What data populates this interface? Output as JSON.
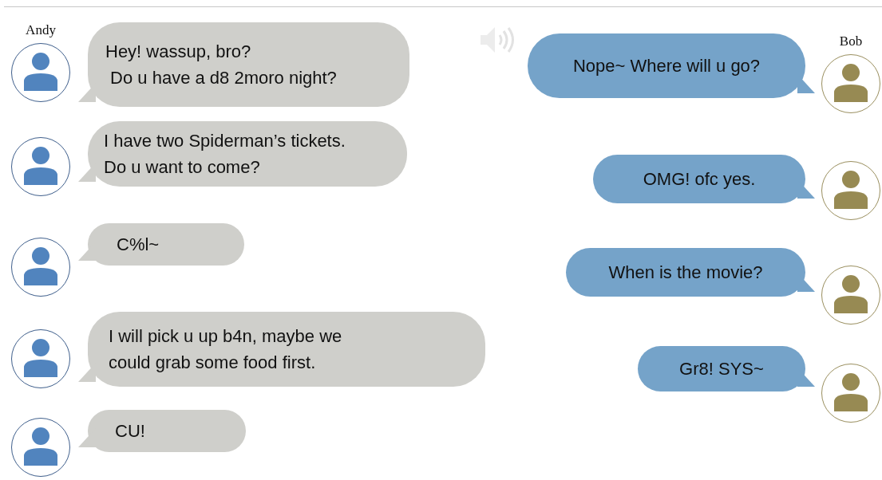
{
  "participants": [
    {
      "name": "Andy",
      "kind": "left",
      "messages": [
        {
          "lines": [
            "Hey! wassup, bro?",
            " Do u have a d8 2moro night?"
          ]
        },
        {
          "lines": [
            "I have two Spiderman’s tickets.",
            "Do u want to come?"
          ]
        },
        {
          "lines": [
            "C%l~"
          ]
        },
        {
          "lines": [
            "I will pick u up b4n, maybe we",
            "could grab some food first."
          ]
        },
        {
          "lines": [
            "CU!"
          ]
        }
      ]
    },
    {
      "name": "Bob",
      "kind": "right",
      "messages": [
        {
          "lines": [
            "Nope~ Where will u go?"
          ]
        },
        {
          "lines": [
            "OMG! ofc yes."
          ]
        },
        {
          "lines": [
            "When is the movie?"
          ]
        },
        {
          "lines": [
            "Gr8! SYS~"
          ]
        }
      ]
    }
  ]
}
